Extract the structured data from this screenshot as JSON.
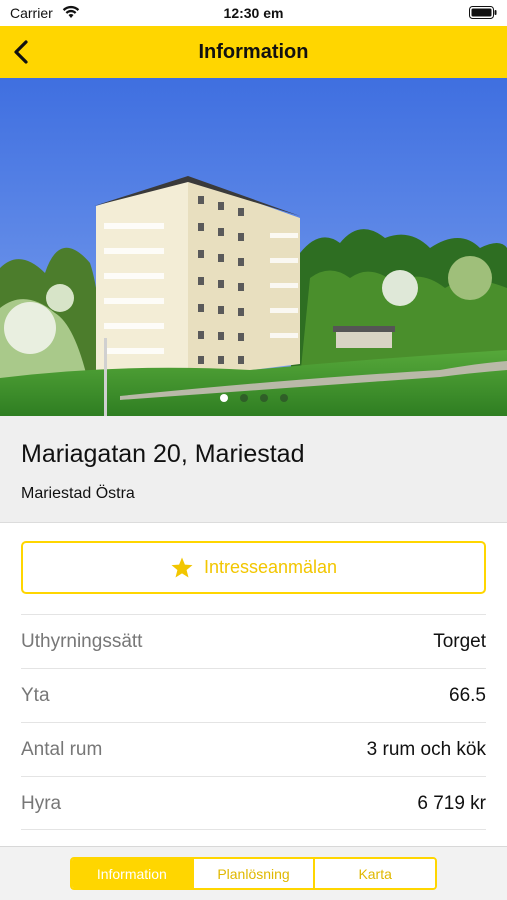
{
  "status_bar": {
    "carrier": "Carrier",
    "time": "12:30 em"
  },
  "nav": {
    "title": "Information",
    "back_icon": "chevron-left-icon"
  },
  "gallery": {
    "page_count": 4,
    "active_index": 0
  },
  "listing": {
    "address": "Mariagatan 20, Mariestad",
    "area": "Mariestad Östra"
  },
  "interest_button": {
    "label": "Intresseanmälan",
    "icon": "star-icon"
  },
  "details": [
    {
      "label": "Uthyrningssätt",
      "value": "Torget"
    },
    {
      "label": "Yta",
      "value": "66.5"
    },
    {
      "label": "Antal rum",
      "value": "3 rum och kök"
    },
    {
      "label": "Hyra",
      "value": "6 719 kr"
    }
  ],
  "tabs": {
    "active_index": 0,
    "items": [
      {
        "label": "Information"
      },
      {
        "label": "Planlösning"
      },
      {
        "label": "Karta"
      }
    ]
  },
  "colors": {
    "accent": "#ffd600",
    "accent_text": "#f2c600",
    "sky": "#4e7ae0",
    "grass": "#3e8f2a"
  }
}
